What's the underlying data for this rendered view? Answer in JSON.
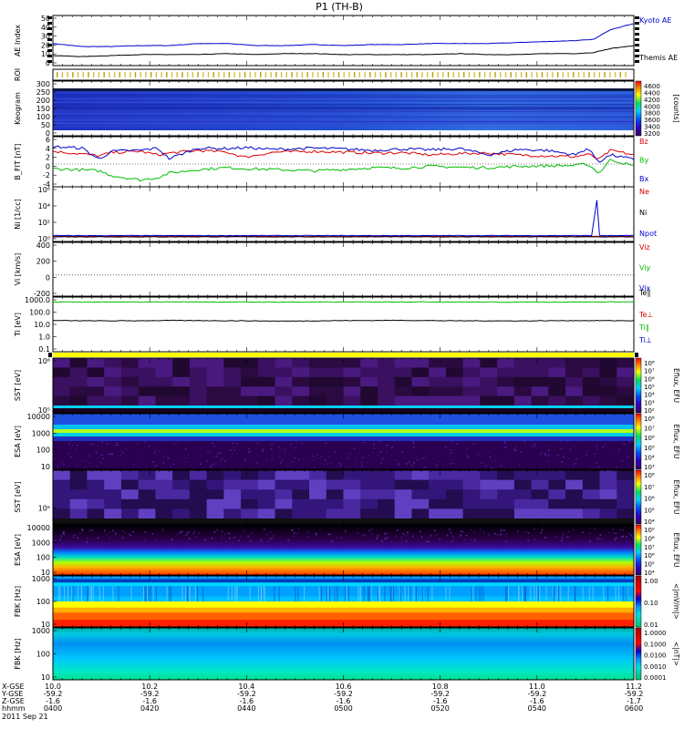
{
  "title": "P1 (TH-B)",
  "date_label": "2011 Sep 21",
  "colors": {
    "blue": "#0000cc",
    "red": "#dd0000",
    "green": "#00bb00",
    "black": "#000000",
    "yellow": "#ffff00"
  },
  "xaxis": {
    "row_labels": [
      "X-GSE",
      "Y-GSE",
      "Z-GSE",
      "hhmm"
    ],
    "ticks": [
      {
        "x": "10.0",
        "y": "-59.2",
        "z": "-1.6",
        "hhmm": "0400"
      },
      {
        "x": "10.2",
        "y": "-59.2",
        "z": "-1.6",
        "hhmm": "0420"
      },
      {
        "x": "10.4",
        "y": "-59.2",
        "z": "-1.6",
        "hhmm": "0440"
      },
      {
        "x": "10.6",
        "y": "-59.2",
        "z": "-1.6",
        "hhmm": "0500"
      },
      {
        "x": "10.8",
        "y": "-59.2",
        "z": "-1.6",
        "hhmm": "0520"
      },
      {
        "x": "11.0",
        "y": "-59.2",
        "z": "-1.6",
        "hhmm": "0540"
      },
      {
        "x": "11.2",
        "y": "-59.2",
        "z": "-1.7",
        "hhmm": "0600"
      }
    ]
  },
  "chart_data": [
    {
      "type": "line",
      "ylabel": "AE Index",
      "yticks": [
        "50",
        "40",
        "30",
        "20",
        "10",
        "0"
      ],
      "ylim": [
        0,
        50
      ],
      "x": [
        0,
        0.05,
        0.1,
        0.15,
        0.2,
        0.25,
        0.3,
        0.35,
        0.4,
        0.45,
        0.5,
        0.55,
        0.6,
        0.65,
        0.7,
        0.75,
        0.8,
        0.85,
        0.9,
        0.93,
        0.96,
        1.0
      ],
      "series": [
        {
          "name": "Kyoto AE",
          "color": "#0000cc",
          "values": [
            22,
            19,
            19,
            20,
            20,
            22,
            22,
            20,
            20,
            21,
            20,
            21,
            21,
            22,
            22,
            22,
            23,
            24,
            25,
            26,
            36,
            42
          ]
        },
        {
          "name": "Themis AE",
          "color": "#000000",
          "values": [
            10,
            9,
            10,
            11,
            11,
            11,
            12,
            11,
            12,
            12,
            11,
            11,
            11,
            11,
            12,
            11,
            11,
            12,
            12,
            13,
            17,
            20
          ]
        }
      ]
    },
    {
      "type": "heatmap",
      "ylabel": "ROI",
      "yticks": []
    },
    {
      "type": "heatmap",
      "ylabel": "Keogram",
      "yticks": [
        "300",
        "250",
        "200",
        "150",
        "100",
        "50",
        "0"
      ],
      "ylim": [
        0,
        300
      ],
      "colorbar": {
        "ticks": [
          "4600",
          "4400",
          "4200",
          "4000",
          "3800",
          "3600",
          "3400",
          "3200"
        ],
        "label": "[counts]"
      }
    },
    {
      "type": "line",
      "ylabel": "B_FIT [nT]",
      "yticks": [
        "6",
        "4",
        "2",
        "0",
        "-2",
        "-4"
      ],
      "ylim": [
        -5,
        6
      ],
      "x": [
        0,
        0.05,
        0.08,
        0.1,
        0.15,
        0.18,
        0.2,
        0.25,
        0.3,
        0.33,
        0.38,
        0.45,
        0.5,
        0.55,
        0.6,
        0.65,
        0.7,
        0.75,
        0.8,
        0.85,
        0.9,
        0.92,
        0.94,
        0.96,
        1.0
      ],
      "series": [
        {
          "name": "Bz",
          "color": "#dd0000",
          "values": [
            2.8,
            2.2,
            1.8,
            2.5,
            2.8,
            2.0,
            2.4,
            3.0,
            2.6,
            1.5,
            2.6,
            2.8,
            2.6,
            2.4,
            2.5,
            2.0,
            2.3,
            2.4,
            2.0,
            1.8,
            1.6,
            2.2,
            1.0,
            3.0,
            2.0
          ]
        },
        {
          "name": "By",
          "color": "#00bb00",
          "values": [
            -1.0,
            -1.3,
            -1.5,
            -2.5,
            -3.5,
            -3.0,
            -2.0,
            -1.2,
            -0.8,
            -1.0,
            -1.2,
            -1.5,
            -1.2,
            -0.8,
            -0.9,
            -0.5,
            -0.7,
            -0.8,
            -0.5,
            -0.4,
            -0.3,
            0.0,
            -2.0,
            1.0,
            -0.5
          ]
        },
        {
          "name": "Bx",
          "color": "#0000cc",
          "values": [
            3.8,
            3.5,
            1.0,
            2.8,
            3.0,
            3.5,
            1.2,
            3.5,
            3.4,
            3.6,
            3.2,
            3.5,
            3.3,
            3.0,
            3.3,
            3.1,
            3.4,
            2.0,
            3.2,
            3.0,
            2.0,
            3.5,
            0.5,
            2.0,
            1.0
          ]
        }
      ]
    },
    {
      "type": "line",
      "ylabel": "Ni [1/cc]",
      "yticks": [
        "10⁶",
        "10⁴",
        "10²",
        "10⁰"
      ],
      "ylim": [
        -0.5,
        6
      ],
      "x": [
        0,
        0.2,
        0.4,
        0.6,
        0.8,
        0.93,
        0.935,
        0.94,
        1.0
      ],
      "series": [
        {
          "name": "Ne",
          "color": "#dd0000",
          "values": [
            0.1,
            0.1,
            0.1,
            0.1,
            0.1,
            0.1,
            0.1,
            0.1,
            0.1
          ]
        },
        {
          "name": "Ni",
          "color": "#000000",
          "values": [
            0.05,
            0.05,
            0.05,
            0.05,
            0.05,
            0.05,
            0.05,
            0.05,
            0.05
          ]
        },
        {
          "name": "Npot",
          "color": "#0000cc",
          "values": [
            0.2,
            0.2,
            0.2,
            0.2,
            0.2,
            0.2,
            6.0,
            0.2,
            0.2
          ]
        }
      ]
    },
    {
      "type": "line",
      "ylabel": "Vi [km/s]",
      "yticks": [
        "400",
        "200",
        "0",
        "-200"
      ],
      "ylim": [
        -330,
        510
      ],
      "series": [
        {
          "name": "Vix",
          "color": "#0000cc",
          "values": []
        },
        {
          "name": "Viy",
          "color": "#00bb00",
          "values": []
        },
        {
          "name": "Viz",
          "color": "#dd0000",
          "values": []
        }
      ]
    },
    {
      "type": "line",
      "ylabel": "Ti [eV]",
      "yticks": [
        "1000.0",
        "100.0",
        "10.0",
        "1.0",
        "0.1"
      ],
      "ylim": [
        -1.3,
        3.7
      ],
      "x": [
        0,
        0.1,
        0.2,
        0.3,
        0.4,
        0.5,
        0.6,
        0.7,
        0.8,
        0.9,
        1.0
      ],
      "series": [
        {
          "name": "Ti∥",
          "color": "#00bb00",
          "values": [
            3.25,
            3.24,
            3.26,
            3.25,
            3.24,
            3.25,
            3.26,
            3.25,
            3.24,
            3.25,
            3.26
          ]
        },
        {
          "name": "Ti⊥",
          "color": "#000000",
          "values": [
            1.55,
            1.52,
            1.56,
            1.54,
            1.5,
            1.55,
            1.57,
            1.53,
            1.52,
            1.55,
            1.54
          ]
        }
      ],
      "legend": [
        "Te∥",
        "Te⊥",
        "Ti∥",
        "Ti⊥"
      ]
    },
    {
      "type": "heatmap",
      "ylabel": "SST [eV]",
      "yticks": [
        "10⁶",
        "10⁵"
      ],
      "colorbar": {
        "ticks": [
          "10⁸",
          "10⁷",
          "10⁶",
          "10⁵",
          "10⁴",
          "10³",
          "10²"
        ],
        "label": "Eflux, EFU"
      }
    },
    {
      "type": "heatmap",
      "ylabel": "ESA [eV]",
      "yticks": [
        "10000",
        "1000",
        "100",
        "10"
      ],
      "colorbar": {
        "ticks": [
          "10⁸",
          "10⁷",
          "10⁶",
          "10⁵",
          "10⁴",
          "10³"
        ],
        "label": "Eflux, EFU"
      }
    },
    {
      "type": "heatmap",
      "ylabel": "SST [eV]",
      "yticks": [
        "10⁵"
      ],
      "colorbar": {
        "ticks": [
          "10⁸",
          "10⁷",
          "10⁶",
          "10⁵",
          "10⁴"
        ],
        "label": "Eflux, EFU"
      }
    },
    {
      "type": "heatmap",
      "ylabel": "ESA [eV]",
      "yticks": [
        "10000",
        "1000",
        "100",
        "10"
      ],
      "colorbar": {
        "ticks": [
          "10⁹",
          "10⁸",
          "10⁷",
          "10⁶",
          "10⁵",
          "10⁴"
        ],
        "label": "Eflux, EFU"
      }
    },
    {
      "type": "heatmap",
      "ylabel": "FBK [Hz]",
      "yticks": [
        "1000",
        "100",
        "10"
      ],
      "colorbar": {
        "ticks": [
          "1.00",
          "0.10",
          "0.01"
        ],
        "label": "<|mV/m|>"
      }
    },
    {
      "type": "heatmap",
      "ylabel": "FBK [Hz]",
      "yticks": [
        "1000",
        "100",
        "10"
      ],
      "colorbar": {
        "ticks": [
          "1.0000",
          "0.1000",
          "0.0100",
          "0.0010",
          "0.0001"
        ],
        "label": "<|nT|>"
      }
    }
  ]
}
